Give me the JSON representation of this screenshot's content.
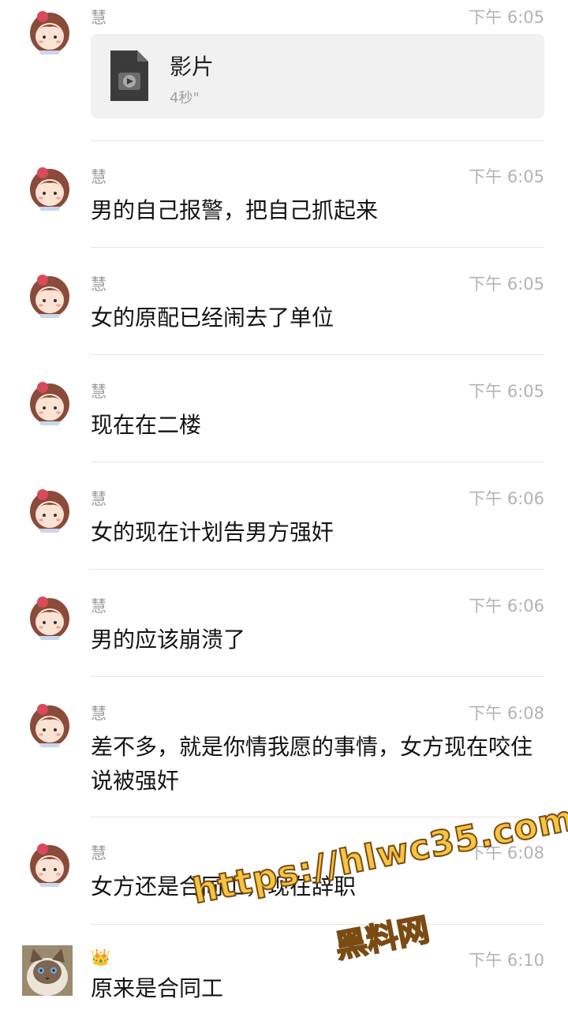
{
  "messages": [
    {
      "sender": "慧",
      "time": "下午 6:05",
      "file": {
        "name": "影片",
        "duration": "4秒\""
      },
      "avatar": "girl-avatar"
    },
    {
      "sender": "慧",
      "time": "下午 6:05",
      "text": "男的自己报警，把自己抓起来",
      "avatar": "girl-avatar"
    },
    {
      "sender": "慧",
      "time": "下午 6:05",
      "text": "女的原配已经闹去了单位",
      "avatar": "girl-avatar"
    },
    {
      "sender": "慧",
      "time": "下午 6:05",
      "text": "现在在二楼",
      "avatar": "girl-avatar"
    },
    {
      "sender": "慧",
      "time": "下午 6:06",
      "text": "女的现在计划告男方强奸",
      "avatar": "girl-avatar"
    },
    {
      "sender": "慧",
      "time": "下午 6:06",
      "text": "男的应该崩溃了",
      "avatar": "girl-avatar"
    },
    {
      "sender": "慧",
      "time": "下午 6:08",
      "text": "差不多，就是你情我愿的事情，女方现在咬住说被强奸",
      "avatar": "girl-avatar"
    },
    {
      "sender": "慧",
      "time": "下午 6:08",
      "text": "女方还是合同工，现在辞职",
      "avatar": "girl-avatar"
    },
    {
      "sender": "👑",
      "time": "下午 6:10",
      "text": "原来是合同工",
      "avatar": "cat-avatar"
    }
  ],
  "watermark": {
    "url": "https://hlwc35.com",
    "name": "黑料网"
  },
  "colors": {
    "time": "#b3b3b3",
    "sender": "#9a9a9a",
    "card": "#f1f1f1",
    "watermark_fill": "#f5c542",
    "watermark_stroke": "#7a4b12"
  }
}
